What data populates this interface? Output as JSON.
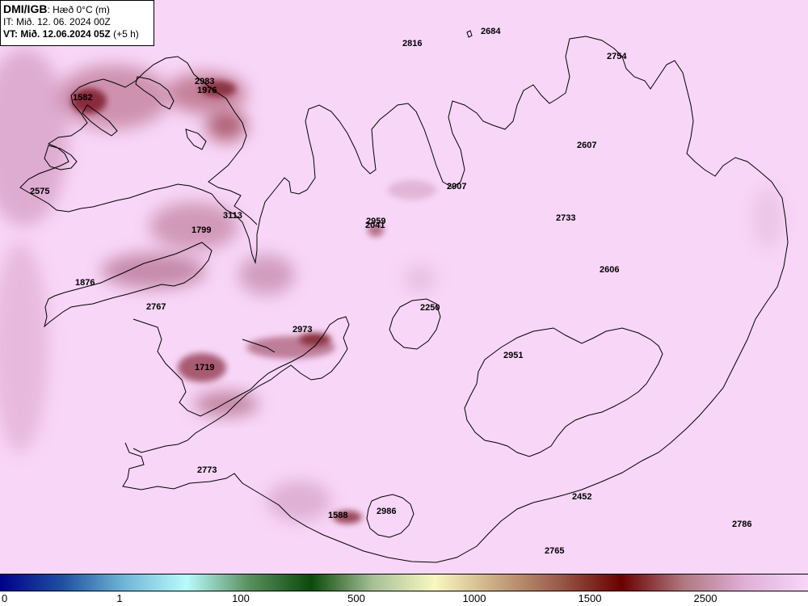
{
  "header": {
    "source": "DMI/IGB",
    "parameter": ": Hæð 0°C (m)",
    "init_time": "IT: Mið. 12. 06. 2024 00Z",
    "valid_prefix": "VT: Mið. 12.06.2024 05Z",
    "valid_suffix": " (+5 h)"
  },
  "colors": {
    "background": "#f8d6f8",
    "coast": "#000000",
    "low_freezing_level": "#a3505e"
  },
  "values": [
    {
      "id": "v2816",
      "label": "2816"
    },
    {
      "id": "v2684",
      "label": "2684"
    },
    {
      "id": "v2754",
      "label": "2754"
    },
    {
      "id": "v2983",
      "label": "2983"
    },
    {
      "id": "v1976",
      "label": "1976"
    },
    {
      "id": "v1582",
      "label": "1582"
    },
    {
      "id": "v2607",
      "label": "2607"
    },
    {
      "id": "v2575",
      "label": "2575"
    },
    {
      "id": "v2907",
      "label": "2907"
    },
    {
      "id": "v3113",
      "label": "3113"
    },
    {
      "id": "v2959",
      "label": "2959"
    },
    {
      "id": "v2041",
      "label": "2041"
    },
    {
      "id": "v2733",
      "label": "2733"
    },
    {
      "id": "v1799",
      "label": "1799"
    },
    {
      "id": "v2606",
      "label": "2606"
    },
    {
      "id": "v1876",
      "label": "1876"
    },
    {
      "id": "v2767",
      "label": "2767"
    },
    {
      "id": "v2250",
      "label": "2250"
    },
    {
      "id": "v2973",
      "label": "2973"
    },
    {
      "id": "v2951",
      "label": "2951"
    },
    {
      "id": "v1719",
      "label": "1719"
    },
    {
      "id": "v2773",
      "label": "2773"
    },
    {
      "id": "v2452",
      "label": "2452"
    },
    {
      "id": "v2786",
      "label": "2786"
    },
    {
      "id": "v1588",
      "label": "1588"
    },
    {
      "id": "v2986",
      "label": "2986"
    },
    {
      "id": "v2765",
      "label": "2765"
    }
  ],
  "colorbar": {
    "ticks": [
      "0",
      "1",
      "100",
      "500",
      "1000",
      "1500",
      "2500"
    ],
    "stops": [
      "#00008a",
      "#1f4fa0",
      "#6fb6d8",
      "#b8fbfb",
      "#5a9060",
      "#0a4a0a",
      "#a8c098",
      "#f8f8c0",
      "#c8a880",
      "#9a5a4a",
      "#6a0000",
      "#b07880",
      "#e0b0d8",
      "#f8d6f8"
    ]
  }
}
